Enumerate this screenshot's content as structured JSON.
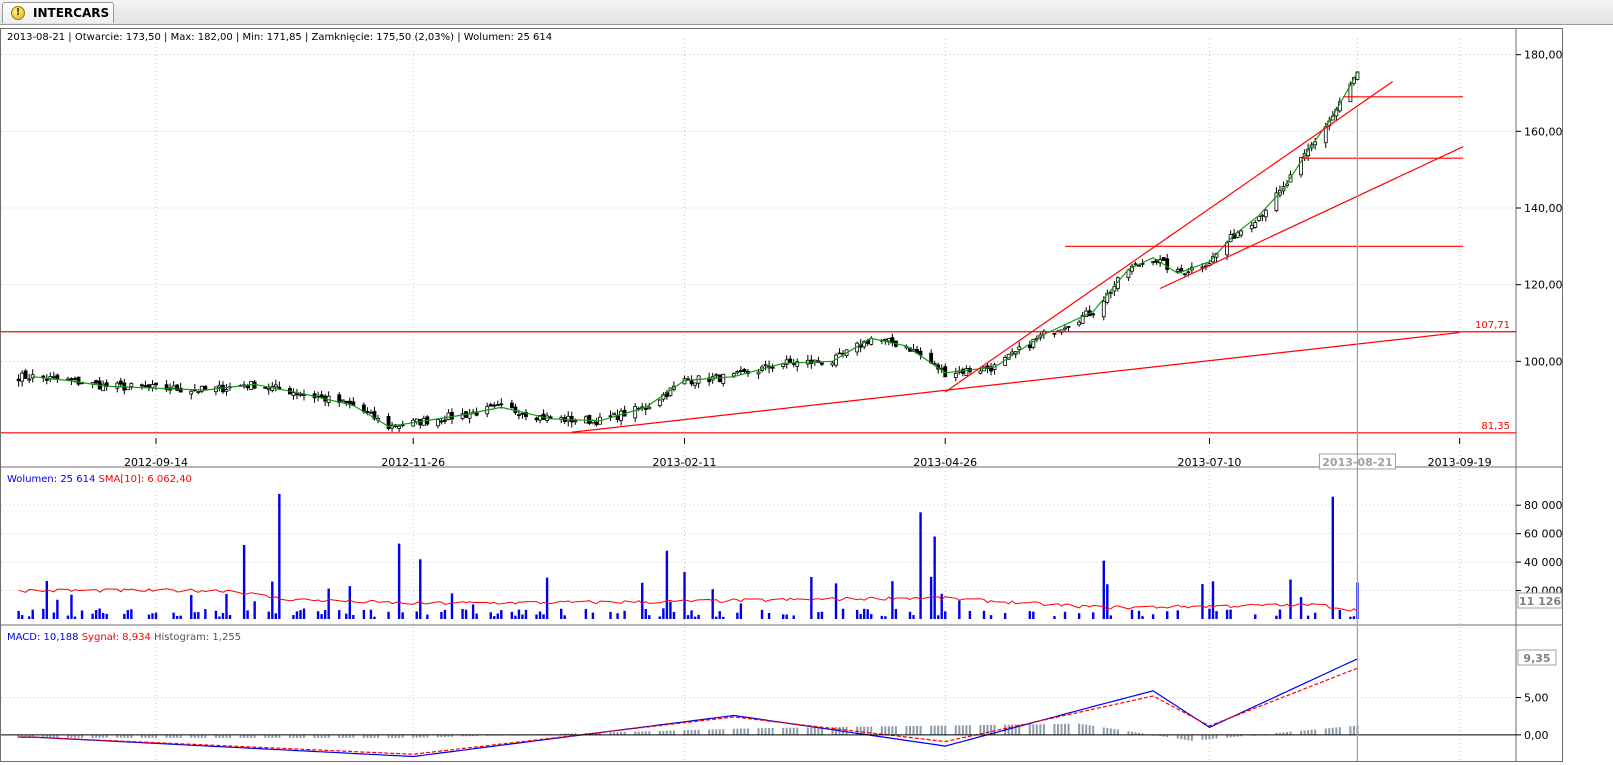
{
  "tab": {
    "icon": "warning-icon",
    "title": "INTERCARS"
  },
  "price_panel": {
    "date": "2013-08-21",
    "open_label": "Otwarcie: 173,50",
    "max_label": "Max: 182,00",
    "min_label": "Min: 171,85",
    "close_label": "Zamknięcie: 175,50 (2,03%)",
    "volume_label": "Wolumen: 25 614"
  },
  "volume_panel": {
    "volume_label": "Wolumen: 25 614",
    "sma_label": "SMA[10]: 6 062,40",
    "last_value_badge": "11 126"
  },
  "macd_panel": {
    "macd_label": "MACD: 10,188",
    "signal_label": "Sygnał: 8,934",
    "histogram_label": "Histogram: 1,255",
    "last_value_badge": "9,35"
  },
  "colors": {
    "candle_up": "#ffffff",
    "candle_down": "#000000",
    "ma_line": "#119a11",
    "trendline": "#ff0000",
    "volume_bar": "#0000ee",
    "sma_line": "#ff0000",
    "macd_line": "#0000ee",
    "signal_line": "#ff0000",
    "histogram": "#8c9caa",
    "cursor": "#a0a0a0",
    "grid": "#c8c8c8"
  },
  "chart_data": [
    {
      "type": "candlestick",
      "title": "",
      "x_ticks": [
        "2012-09-14",
        "2012-11-26",
        "2013-02-11",
        "2013-04-26",
        "2013-07-10",
        "2013-08-21",
        "2013-09-19"
      ],
      "highlighted_tick": "2013-08-21",
      "ylim": [
        80,
        182
      ],
      "y_ticks": [
        100,
        120,
        140,
        160,
        180
      ],
      "y_tick_labels": [
        "100,00",
        "120,00",
        "140,00",
        "160,00",
        "180,00"
      ],
      "grid": true,
      "ma_series_name": "",
      "close_series": [
        {
          "date": "2012-08-10",
          "value": 96.0
        },
        {
          "date": "2012-08-20",
          "value": 95.0
        },
        {
          "date": "2012-08-31",
          "value": 93.5
        },
        {
          "date": "2012-09-14",
          "value": 93.0
        },
        {
          "date": "2012-09-28",
          "value": 92.5
        },
        {
          "date": "2012-10-12",
          "value": 94.0
        },
        {
          "date": "2012-10-26",
          "value": 91.5
        },
        {
          "date": "2012-11-09",
          "value": 88.5
        },
        {
          "date": "2012-11-19",
          "value": 83.0
        },
        {
          "date": "2012-11-26",
          "value": 84.0
        },
        {
          "date": "2012-12-10",
          "value": 86.0
        },
        {
          "date": "2012-12-21",
          "value": 88.0
        },
        {
          "date": "2013-01-04",
          "value": 85.0
        },
        {
          "date": "2013-01-18",
          "value": 84.5
        },
        {
          "date": "2013-01-31",
          "value": 88.0
        },
        {
          "date": "2013-02-11",
          "value": 95.0
        },
        {
          "date": "2013-02-25",
          "value": 96.0
        },
        {
          "date": "2013-03-11",
          "value": 99.5
        },
        {
          "date": "2013-03-25",
          "value": 100.0
        },
        {
          "date": "2013-04-05",
          "value": 106.0
        },
        {
          "date": "2013-04-15",
          "value": 104.0
        },
        {
          "date": "2013-04-26",
          "value": 97.0
        },
        {
          "date": "2013-05-10",
          "value": 98.5
        },
        {
          "date": "2013-05-24",
          "value": 107.0
        },
        {
          "date": "2013-06-07",
          "value": 113.0
        },
        {
          "date": "2013-06-17",
          "value": 124.0
        },
        {
          "date": "2013-06-24",
          "value": 127.0
        },
        {
          "date": "2013-07-01",
          "value": 123.0
        },
        {
          "date": "2013-07-10",
          "value": 126.0
        },
        {
          "date": "2013-07-17",
          "value": 133.0
        },
        {
          "date": "2013-07-24",
          "value": 138.0
        },
        {
          "date": "2013-07-31",
          "value": 145.0
        },
        {
          "date": "2013-08-07",
          "value": 155.0
        },
        {
          "date": "2013-08-14",
          "value": 164.0
        },
        {
          "date": "2013-08-19",
          "value": 172.0
        },
        {
          "date": "2013-08-21",
          "value": 175.5
        }
      ],
      "lines": [
        {
          "label": "107,71",
          "kind": "horizontal",
          "y": 107.71
        },
        {
          "label": "81,35",
          "kind": "horizontal",
          "y": 81.35
        },
        {
          "label": "",
          "kind": "segment",
          "from": [
            "2013-01-10",
            81.5
          ],
          "to": [
            "2013-09-19",
            107.5
          ]
        },
        {
          "label": "",
          "kind": "segment",
          "from": [
            "2013-04-26",
            92.0
          ],
          "to": [
            "2013-08-31",
            173.0
          ]
        },
        {
          "label": "",
          "kind": "segment",
          "from": [
            "2013-06-26",
            119.0
          ],
          "to": [
            "2013-09-20",
            156.0
          ]
        },
        {
          "label": "",
          "kind": "horizontal_segment",
          "y": 130.0,
          "from": "2013-05-30",
          "to": "2013-09-20"
        },
        {
          "label": "",
          "kind": "horizontal_segment",
          "y": 153.0,
          "from": "2013-08-05",
          "to": "2013-09-20"
        },
        {
          "label": "",
          "kind": "horizontal_segment",
          "y": 169.0,
          "from": "2013-08-17",
          "to": "2013-09-20"
        }
      ]
    },
    {
      "type": "bar",
      "title": "",
      "ylim": [
        0,
        90000
      ],
      "y_ticks": [
        20000,
        40000,
        60000,
        80000
      ],
      "y_tick_labels": [
        "20 000",
        "40 000",
        "60 000",
        "80 000"
      ],
      "grid": true,
      "series": [
        {
          "kind": "bar",
          "points": [
            {
              "date": "2012-10-07",
              "value": 58000
            },
            {
              "date": "2012-10-09",
              "value": 52000
            },
            {
              "date": "2012-10-19",
              "value": 88000
            },
            {
              "date": "2012-11-22",
              "value": 53000
            },
            {
              "date": "2012-11-28",
              "value": 42000
            },
            {
              "date": "2013-02-06",
              "value": 48000
            },
            {
              "date": "2013-02-11",
              "value": 33000
            },
            {
              "date": "2013-04-19",
              "value": 75000
            },
            {
              "date": "2013-04-23",
              "value": 58000
            },
            {
              "date": "2013-06-10",
              "value": 41000
            },
            {
              "date": "2013-08-14",
              "value": 86000
            },
            {
              "date": "2013-08-21",
              "value": 25614
            }
          ]
        },
        {
          "kind": "line",
          "points": [
            {
              "date": "2012-10-05",
              "value": 20000
            },
            {
              "date": "2012-10-20",
              "value": 14000
            },
            {
              "date": "2012-11-25",
              "value": 11000
            },
            {
              "date": "2013-01-31",
              "value": 12000
            },
            {
              "date": "2013-04-22",
              "value": 15000
            },
            {
              "date": "2013-06-10",
              "value": 8000
            },
            {
              "date": "2013-08-10",
              "value": 10000
            },
            {
              "date": "2013-08-21",
              "value": 6062.4
            }
          ]
        }
      ]
    },
    {
      "type": "line",
      "title": "",
      "ylim": [
        -3.5,
        11.5
      ],
      "y_ticks": [
        0,
        5
      ],
      "y_tick_labels": [
        "0,00",
        "5,00"
      ],
      "grid": true,
      "series": [
        {
          "kind": "line",
          "points": [
            {
              "date": "2012-08-10",
              "value": -0.3
            },
            {
              "date": "2012-11-26",
              "value": -2.9
            },
            {
              "date": "2013-02-25",
              "value": 2.6
            },
            {
              "date": "2013-04-26",
              "value": -1.5
            },
            {
              "date": "2013-06-07",
              "value": 3.8
            },
            {
              "date": "2013-06-24",
              "value": 5.9
            },
            {
              "date": "2013-07-10",
              "value": 1.0
            },
            {
              "date": "2013-08-21",
              "value": 10.188
            }
          ]
        },
        {
          "kind": "line",
          "points": [
            {
              "date": "2012-08-10",
              "value": -0.3
            },
            {
              "date": "2012-11-26",
              "value": -2.6
            },
            {
              "date": "2013-02-25",
              "value": 2.4
            },
            {
              "date": "2013-04-26",
              "value": -0.9
            },
            {
              "date": "2013-06-24",
              "value": 5.2
            },
            {
              "date": "2013-07-10",
              "value": 1.2
            },
            {
              "date": "2013-08-21",
              "value": 8.934
            }
          ]
        },
        {
          "kind": "bar",
          "points": [
            {
              "date": "2012-11-26",
              "value": -0.4
            },
            {
              "date": "2013-03-04",
              "value": 0.9
            },
            {
              "date": "2013-06-03",
              "value": 1.5
            },
            {
              "date": "2013-07-05",
              "value": -0.8
            },
            {
              "date": "2013-08-21",
              "value": 1.255
            }
          ]
        }
      ]
    }
  ]
}
